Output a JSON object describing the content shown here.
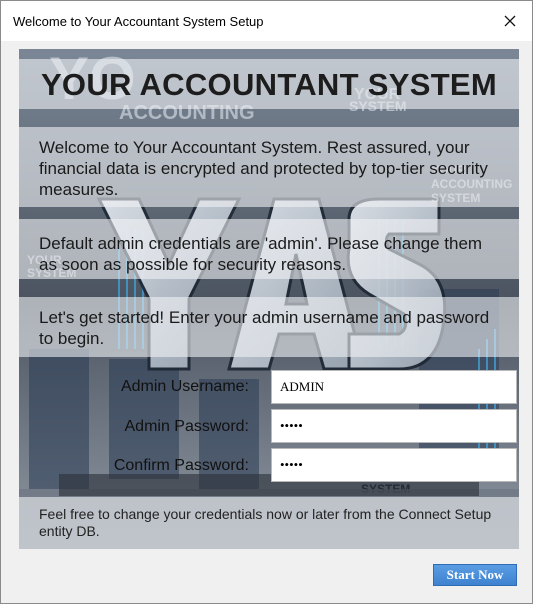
{
  "window": {
    "title": "Welcome to Your Accountant System Setup"
  },
  "panel": {
    "heading": "YOUR ACCOUNTANT SYSTEM",
    "intro": "Welcome to Your Accountant System. Rest assured, your financial data is encrypted and protected by top-tier security measures.",
    "credentials_note": "Default admin credentials are 'admin'. Please change them as soon as possible for security reasons.",
    "get_started": "Let's get started! Enter your admin username and password to begin.",
    "footer_note": "Feel free to change your credentials now or later from the Connect Setup entity DB.",
    "background_art_text": [
      "YOUR ACCOUNTING SYSTEM",
      "YAS",
      "SYSTEM"
    ]
  },
  "form": {
    "username_label": "Admin Username:",
    "username_value": "ADMIN",
    "password_label": "Admin Password:",
    "password_value": "admin",
    "confirm_label": "Confirm Password:",
    "confirm_value": "admin"
  },
  "actions": {
    "start_label": "Start Now"
  },
  "icons": {
    "close": "close-icon"
  },
  "colors": {
    "accent": "#3e82d0",
    "panel_band": "#f0f2f5"
  }
}
